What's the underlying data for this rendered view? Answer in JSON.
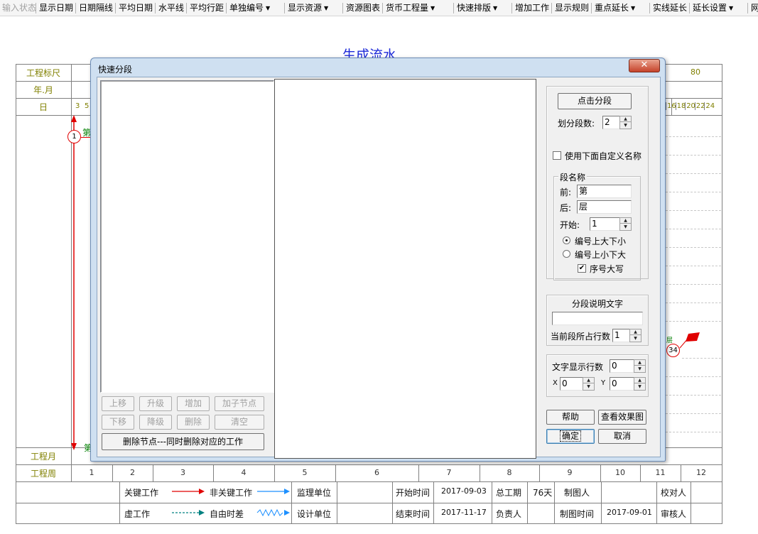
{
  "toolbar": {
    "items": [
      {
        "label": "输入状态",
        "disabled": true
      },
      {
        "label": "显示日期"
      },
      {
        "label": "日期隔线"
      },
      {
        "label": "平均日期"
      },
      {
        "label": "水平线"
      },
      {
        "label": "平均行距"
      },
      {
        "label": "单独编号",
        "dropdown": true
      },
      {
        "label": "显示资源",
        "dropdown": true
      },
      {
        "label": "资源图表"
      },
      {
        "label": "货币工程量",
        "dropdown": true
      },
      {
        "label": "快速排版",
        "dropdown": true
      },
      {
        "label": "增加工作"
      },
      {
        "label": "显示规则"
      },
      {
        "label": "重点延长",
        "dropdown": true
      },
      {
        "label": "实线延长"
      },
      {
        "label": "延长设置",
        "dropdown": true
      },
      {
        "label": "网络计划"
      }
    ]
  },
  "chart": {
    "title": "生成流水",
    "rows": {
      "ruler": "工程标尺",
      "year_month": "年.月",
      "day": "日",
      "project_month": "工程月",
      "project_week": "工程周"
    },
    "ruler_value": "80",
    "day_ticks_left": [
      "3",
      "5"
    ],
    "day_ticks_right": [
      "16",
      "18",
      "20",
      "22",
      "24"
    ],
    "task_label_left": "第",
    "node_start": "1",
    "node_end": "34",
    "weeks": [
      "1",
      "2",
      "3",
      "4",
      "5",
      "6",
      "7",
      "8",
      "9",
      "10",
      "11",
      "12"
    ],
    "footer": {
      "key_work": "关键工作",
      "non_key_work": "非关键工作",
      "virtual_work": "虚工作",
      "free_float": "自由时差",
      "supervisor": "监理单位",
      "designer": "设计单位",
      "start_time_label": "开始时间",
      "start_time": "2017-09-03",
      "end_time_label": "结束时间",
      "end_time": "2017-11-17",
      "total_duration_label": "总工期",
      "total_duration": "76天",
      "responsible_label": "负责人",
      "drafter_label": "制图人",
      "draft_time_label": "制图时间",
      "draft_time": "2017-09-01",
      "checker_label": "校对人",
      "reviewer_label": "审核人"
    },
    "colors": {
      "critical": "#e00000",
      "noncritical": "#1e90ff",
      "title": "#1d2ad8"
    }
  },
  "dialog": {
    "title": "快速分段",
    "close_icon": "close-icon",
    "tree_buttons": {
      "up": "上移",
      "promote": "升级",
      "add": "增加",
      "add_child": "加子节点",
      "down": "下移",
      "demote": "降级",
      "delete": "删除",
      "clear": "清空",
      "delete_node": "删除节点---同时删除对应的工作"
    },
    "split": {
      "button": "点击分段",
      "count_label": "划分段数:",
      "count_value": "2",
      "custom_name_label": "使用下面自定义名称",
      "custom_name_checked": false
    },
    "segment_name": {
      "legend": "段名称",
      "prefix_label": "前:",
      "prefix_value": "第",
      "suffix_label": "后:",
      "suffix_value": "层",
      "start_label": "开始:",
      "start_value": "1",
      "radio_big_small": "编号上大下小",
      "radio_small_big": "编号上小下大",
      "selected": "big_small",
      "uppercase_label": "序号大写",
      "uppercase_checked": true
    },
    "description": {
      "legend": "分段说明文字",
      "text_value": "",
      "rows_label": "当前段所占行数",
      "rows_value": "1"
    },
    "text_display": {
      "rows_label": "文字显示行数",
      "rows_value": "0",
      "x_label": "X",
      "x_value": "0",
      "y_label": "Y",
      "y_value": "0"
    },
    "buttons": {
      "help": "帮助",
      "preview": "查看效果图",
      "ok": "确定",
      "cancel": "取消"
    }
  }
}
